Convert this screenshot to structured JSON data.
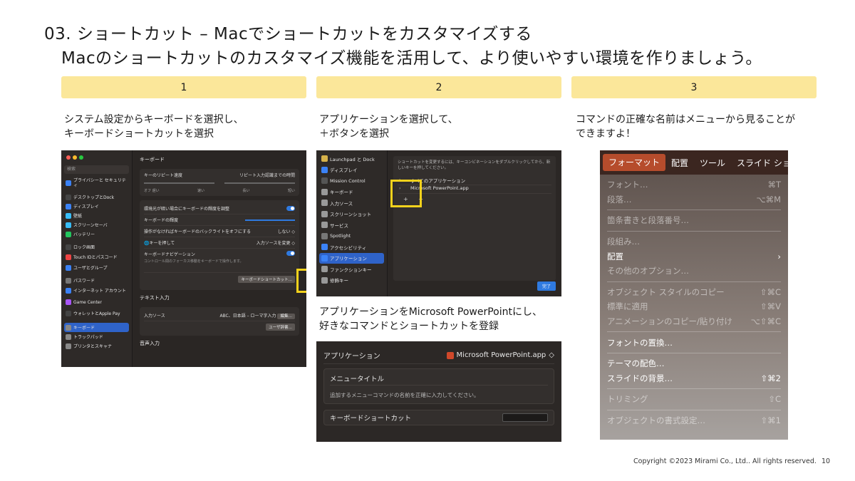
{
  "title_line1": "03. ショートカット – Macでショートカットをカスタマイズする",
  "title_line2": "Macのショートカットのカスタマイズ機能を活用して、より使いやすい環境を作りましょう。",
  "steps": [
    {
      "number": "1",
      "desc_line1": "システム設定からキーボードを選択し、",
      "desc_line2": "キーボードショートカットを選択"
    },
    {
      "number": "2",
      "desc_line1": "アプリケーションを選択して、",
      "desc_line2": "＋ボタンを選択"
    },
    {
      "number": "3",
      "desc_line1": "コマンドの正確な名前はメニューから見ることが",
      "desc_line2": "できますよ！"
    }
  ],
  "step2_extra": {
    "desc_line1": "アプリケーションをMicrosoft PowerPointにし、",
    "desc_line2": "好きなコマンドとショートカットを登録"
  },
  "shot1": {
    "search_placeholder": "検索",
    "sidebar": [
      {
        "label": "プライバシーと セキュリティ",
        "color": "#3b82f6"
      },
      {
        "label": "デスクトップとDock",
        "color": "#444"
      },
      {
        "label": "ディスプレイ",
        "color": "#3b82f6"
      },
      {
        "label": "壁紙",
        "color": "#38bdf8"
      },
      {
        "label": "スクリーンセーバ",
        "color": "#38bdf8"
      },
      {
        "label": "バッテリー",
        "color": "#22c55e"
      },
      {
        "label": "ロック画面",
        "color": "#444"
      },
      {
        "label": "Touch IDとパスコード",
        "color": "#ef4444"
      },
      {
        "label": "ユーザとグループ",
        "color": "#3b82f6"
      },
      {
        "label": "パスワード",
        "color": "#777"
      },
      {
        "label": "インターネット アカウント",
        "color": "#3b82f6"
      },
      {
        "label": "Game Center",
        "color": "#a855f7"
      },
      {
        "label": "ウォレットとApple Pay",
        "color": "#444"
      },
      {
        "label": "キーボード",
        "color": "#888"
      },
      {
        "label": "トラックパッド",
        "color": "#888"
      },
      {
        "label": "プリンタとスキャナ",
        "color": "#888"
      }
    ],
    "main_title": "キーボード",
    "repeat_label": "キーのリピート速度",
    "delay_label": "リピート入力認識までの時間",
    "scale_left": "オフ 遅い",
    "scale_mid": "速い",
    "scale_mid2": "長い",
    "scale_right": "短い",
    "rows": [
      {
        "label": "環境光が暗い場合にキーボードの輝度を調整",
        "value": ""
      },
      {
        "label": "キーボードの輝度",
        "value": ""
      },
      {
        "label": "操作がなければキーボードのバックライトをオフにする",
        "value": "しない ◇"
      },
      {
        "label": "🌐キーを押して",
        "value": "入力ソースを変更 ◇"
      },
      {
        "label": "キーボードナビゲーション",
        "value": ""
      }
    ],
    "nav_desc": "コントロール間のフォーカス移動をキーボードで操作します。",
    "shortcut_button": "キーボードショートカット…",
    "text_input_title": "テキスト入力",
    "input_source_label": "入力ソース",
    "input_source_value": "ABC、日本語 – ローマ字入力",
    "edit_button": "編集…",
    "user_dict_button": "ユーザ辞書…",
    "voice_title": "音声入力"
  },
  "shot2": {
    "sidebar": [
      {
        "label": "Launchpad と Dock",
        "color": "#d6b24a"
      },
      {
        "label": "ディスプレイ",
        "color": "#3b82f6"
      },
      {
        "label": "Mission Control",
        "color": "#555"
      },
      {
        "label": "キーボード",
        "color": "#999"
      },
      {
        "label": "入力ソース",
        "color": "#999"
      },
      {
        "label": "スクリーンショット",
        "color": "#999"
      },
      {
        "label": "サービス",
        "color": "#999"
      },
      {
        "label": "Spotlight",
        "color": "#777"
      },
      {
        "label": "アクセシビリティ",
        "color": "#3b82f6"
      },
      {
        "label": "アプリケーション",
        "color": "#3b82f6"
      },
      {
        "label": "ファンクションキー",
        "color": "#999"
      },
      {
        "label": "修飾キー",
        "color": "#999"
      }
    ],
    "info_text": "ショートカットを変更するには、キーコンビネーションをダブルクリックしてから、新しいキーを押してください。",
    "list": [
      "すべてのアプリケーション",
      "Microsoft PowerPoint.app"
    ],
    "plus_minus": "+ −",
    "done_button": "完了"
  },
  "shot3": {
    "app_label": "アプリケーション",
    "app_value": "Microsoft PowerPoint.app",
    "menu_title_label": "メニュータイトル",
    "hint": "追加するメニューコマンドの名前を正確に入力してください。",
    "shortcut_label": "キーボードショートカット"
  },
  "shot4": {
    "menubar": [
      "フォーマット",
      "配置",
      "ツール",
      "スライド ショ"
    ],
    "items": [
      {
        "label": "フォント…",
        "shortcut": "⌘T",
        "disabled": true
      },
      {
        "label": "段落…",
        "shortcut": "⌥⌘M",
        "disabled": true
      },
      {
        "sep": true
      },
      {
        "label": "箇条書きと段落番号…",
        "shortcut": "",
        "disabled": true
      },
      {
        "sep": true
      },
      {
        "label": "段組み…",
        "shortcut": "",
        "disabled": true
      },
      {
        "label": "配置",
        "shortcut": "›",
        "disabled": false
      },
      {
        "label": "その他のオプション…",
        "shortcut": "",
        "disabled": true
      },
      {
        "sep": true
      },
      {
        "label": "オブジェクト スタイルのコピー",
        "shortcut": "⇧⌘C",
        "disabled": true
      },
      {
        "label": "標準に適用",
        "shortcut": "⇧⌘V",
        "disabled": true
      },
      {
        "label": "アニメーションのコピー/貼り付け",
        "shortcut": "⌥⇧⌘C",
        "disabled": true
      },
      {
        "sep": true
      },
      {
        "label": "フォントの置換…",
        "shortcut": "",
        "disabled": false
      },
      {
        "sep": true
      },
      {
        "label": "テーマの配色…",
        "shortcut": "",
        "disabled": false
      },
      {
        "label": "スライドの背景…",
        "shortcut": "⇧⌘2",
        "disabled": false
      },
      {
        "sep": true
      },
      {
        "label": "トリミング",
        "shortcut": "⇧C",
        "disabled": true
      },
      {
        "sep": true
      },
      {
        "label": "オブジェクトの書式設定…",
        "shortcut": "⇧⌘1",
        "disabled": true
      }
    ]
  },
  "footer": {
    "copyright": "Copyright ©2023 Mirami Co., Ltd.. All rights reserved.",
    "page": "10"
  }
}
